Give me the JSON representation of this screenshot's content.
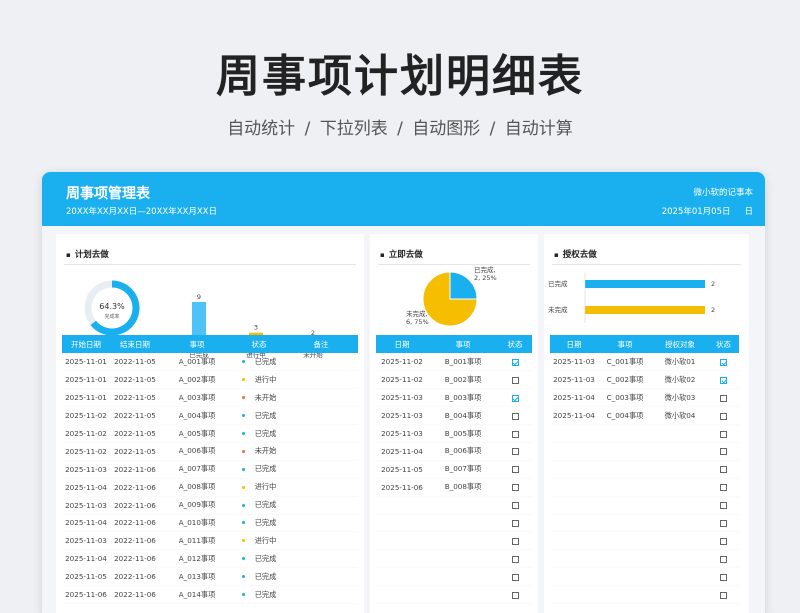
{
  "hero": {
    "title": "周事项计划明细表",
    "subtitle": "自动统计  /  下拉列表  /  自动图形  /  自动计算"
  },
  "header": {
    "title": "周事项管理表",
    "range": "20XX年XX月XX日—20XX年XX月XX日",
    "owner": "微小软的记事本",
    "date": "2025年01月05日",
    "weekday": "日"
  },
  "colors": {
    "accent": "#1ab0f0",
    "done": "#1ab0f0",
    "progress": "#f5be00",
    "todo": "#f07020"
  },
  "plan": {
    "title": "计划去做",
    "gauge": {
      "value": "64.3%",
      "label": "完成率",
      "fraction": 0.643
    },
    "chart_data": {
      "type": "bar",
      "categories": [
        "已完成",
        "进行中",
        "未开始"
      ],
      "values": [
        9,
        3,
        2
      ],
      "colors": [
        "#4fc3f7",
        "#f5be00",
        "#f07020"
      ]
    },
    "columns": [
      "开始日期",
      "结束日期",
      "事项",
      "状态",
      "备注"
    ],
    "rows": [
      {
        "start": "2025-11-01",
        "end": "2022-11-05",
        "item": "A_001事项",
        "status": "已完成",
        "color": "#1ab0f0"
      },
      {
        "start": "2025-11-01",
        "end": "2022-11-05",
        "item": "A_002事项",
        "status": "进行中",
        "color": "#f5be00"
      },
      {
        "start": "2025-11-01",
        "end": "2022-11-05",
        "item": "A_003事项",
        "status": "未开始",
        "color": "#f07020"
      },
      {
        "start": "2025-11-02",
        "end": "2022-11-05",
        "item": "A_004事项",
        "status": "已完成",
        "color": "#1ab0f0"
      },
      {
        "start": "2025-11-02",
        "end": "2022-11-05",
        "item": "A_005事项",
        "status": "已完成",
        "color": "#1ab0f0"
      },
      {
        "start": "2025-11-02",
        "end": "2022-11-05",
        "item": "A_006事项",
        "status": "未开始",
        "color": "#f07020"
      },
      {
        "start": "2025-11-03",
        "end": "2022-11-06",
        "item": "A_007事项",
        "status": "已完成",
        "color": "#1ab0f0"
      },
      {
        "start": "2025-11-04",
        "end": "2022-11-06",
        "item": "A_008事项",
        "status": "进行中",
        "color": "#f5be00"
      },
      {
        "start": "2025-11-03",
        "end": "2022-11-06",
        "item": "A_009事项",
        "status": "已完成",
        "color": "#1ab0f0"
      },
      {
        "start": "2025-11-04",
        "end": "2022-11-06",
        "item": "A_010事项",
        "status": "已完成",
        "color": "#1ab0f0"
      },
      {
        "start": "2025-11-03",
        "end": "2022-11-06",
        "item": "A_011事项",
        "status": "进行中",
        "color": "#f5be00"
      },
      {
        "start": "2025-11-04",
        "end": "2022-11-06",
        "item": "A_012事项",
        "status": "已完成",
        "color": "#1ab0f0"
      },
      {
        "start": "2025-11-05",
        "end": "2022-11-06",
        "item": "A_013事项",
        "status": "已完成",
        "color": "#1ab0f0"
      },
      {
        "start": "2025-11-06",
        "end": "2022-11-06",
        "item": "A_014事项",
        "status": "已完成",
        "color": "#1ab0f0"
      }
    ]
  },
  "immediate": {
    "title": "立即去做",
    "chart_data": {
      "type": "pie",
      "slices": [
        {
          "name": "已完成",
          "value": 2,
          "percent": 25,
          "label": "已完成, 2, 25%",
          "color": "#1ab0f0"
        },
        {
          "name": "未完成",
          "value": 6,
          "percent": 75,
          "label": "未完成, 6, 75%",
          "color": "#f5be00"
        }
      ]
    },
    "columns": [
      "日期",
      "事项",
      "状态"
    ],
    "rows": [
      {
        "date": "2025-11-02",
        "item": "B_001事项",
        "checked": true
      },
      {
        "date": "2025-11-02",
        "item": "B_002事项",
        "checked": false
      },
      {
        "date": "2025-11-03",
        "item": "B_003事项",
        "checked": true
      },
      {
        "date": "2025-11-03",
        "item": "B_004事项",
        "checked": false
      },
      {
        "date": "2025-11-03",
        "item": "B_005事项",
        "checked": false
      },
      {
        "date": "2025-11-04",
        "item": "B_006事项",
        "checked": false
      },
      {
        "date": "2025-11-05",
        "item": "B_007事项",
        "checked": false
      },
      {
        "date": "2025-11-06",
        "item": "B_008事项",
        "checked": false
      }
    ],
    "empty_rows": 6
  },
  "delegate": {
    "title": "授权去做",
    "chart_data": {
      "type": "bar",
      "orientation": "horizontal",
      "categories": [
        "已完成",
        "未完成"
      ],
      "values": [
        2,
        2
      ],
      "colors": [
        "#1ab0f0",
        "#f5be00"
      ]
    },
    "columns": [
      "日期",
      "事项",
      "授权对象",
      "状态"
    ],
    "rows": [
      {
        "date": "2025-11-03",
        "item": "C_001事项",
        "to": "微小软01",
        "checked": true
      },
      {
        "date": "2025-11-03",
        "item": "C_002事项",
        "to": "微小软02",
        "checked": true
      },
      {
        "date": "2025-11-04",
        "item": "C_003事项",
        "to": "微小软03",
        "checked": false
      },
      {
        "date": "2025-11-04",
        "item": "C_004事项",
        "to": "微小软04",
        "checked": false
      }
    ],
    "empty_rows": 10
  }
}
